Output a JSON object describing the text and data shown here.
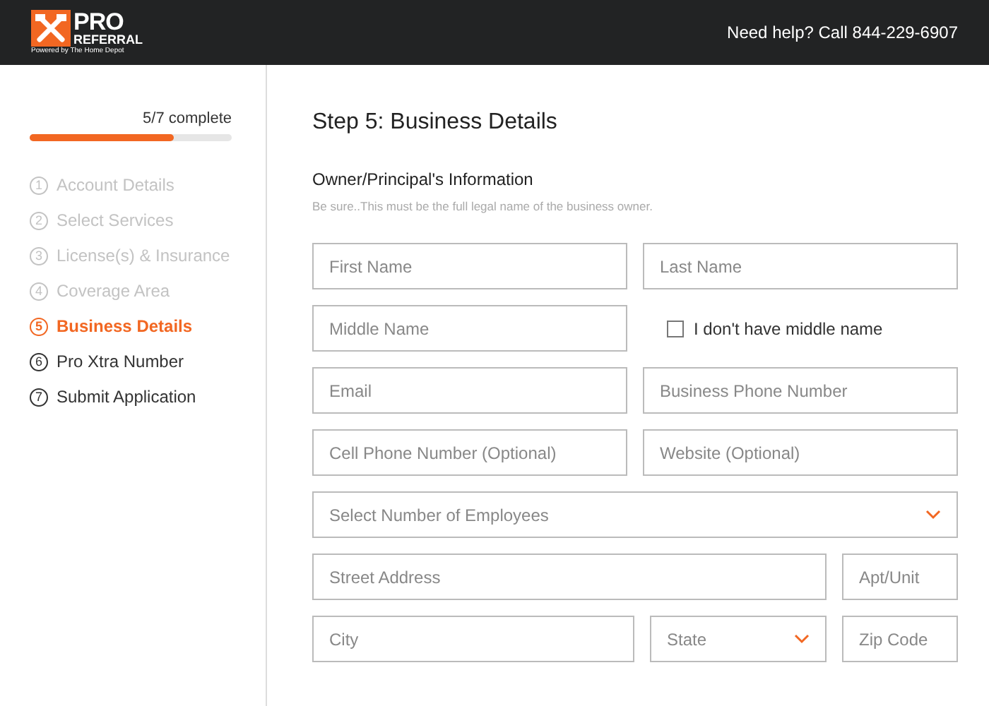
{
  "header": {
    "logo": {
      "line_1": "PRO",
      "line_2": "REFERRAL",
      "tagline": "Powered by The Home Depot"
    },
    "help": "Need help? Call 844-229-6907"
  },
  "sidebar": {
    "progress": {
      "label": "5/7 complete",
      "level": 0.71
    },
    "steps": [
      {
        "number": "1",
        "label": "Account Details",
        "completed": true,
        "selected": false
      },
      {
        "number": "2",
        "label": "Select Services",
        "completed": true,
        "selected": false
      },
      {
        "number": "3",
        "label": "License(s) & Insurance",
        "completed": true,
        "selected": false
      },
      {
        "number": "4",
        "label": "Coverage Area",
        "completed": true,
        "selected": false
      },
      {
        "number": "5",
        "label": "Business Details",
        "completed": false,
        "selected": true
      },
      {
        "number": "6",
        "label": "Pro Xtra Number",
        "completed": false,
        "selected": false
      },
      {
        "number": "7",
        "label": "Submit Application",
        "completed": false,
        "selected": false
      }
    ]
  },
  "main": {
    "title": "Step 5: Business Details",
    "section": "Owner/Principal's Information",
    "hint": "Be sure..This must be the full legal name of the business owner.",
    "rows": [
      {
        "kind": "pair",
        "fields": [
          {
            "kind": "input",
            "placeholder": "First Name"
          },
          {
            "kind": "input",
            "placeholder": "Last Name"
          }
        ]
      },
      {
        "kind": "pair",
        "fields": [
          {
            "kind": "input",
            "placeholder": "Middle Name"
          },
          {
            "kind": "checkbox",
            "label": "I don't have middle name",
            "checked": false
          }
        ]
      },
      {
        "kind": "pair",
        "fields": [
          {
            "kind": "input",
            "placeholder": "Email"
          },
          {
            "kind": "input",
            "placeholder": "Business Phone Number"
          }
        ]
      },
      {
        "kind": "pair",
        "fields": [
          {
            "kind": "input",
            "placeholder": "Cell Phone Number (Optional)"
          },
          {
            "kind": "input",
            "placeholder": "Website (Optional)"
          }
        ]
      },
      {
        "kind": "full",
        "fields": [
          {
            "kind": "select",
            "placeholder": "Select Number of Employees"
          }
        ]
      },
      {
        "kind": "street",
        "fields": [
          {
            "kind": "input",
            "placeholder": "Street Address"
          },
          {
            "kind": "input",
            "placeholder": "Apt/Unit"
          }
        ]
      },
      {
        "kind": "city",
        "fields": [
          {
            "kind": "input",
            "placeholder": "City"
          },
          {
            "kind": "select",
            "placeholder": "State"
          },
          {
            "kind": "input",
            "placeholder": "Zip Code"
          }
        ]
      }
    ]
  }
}
